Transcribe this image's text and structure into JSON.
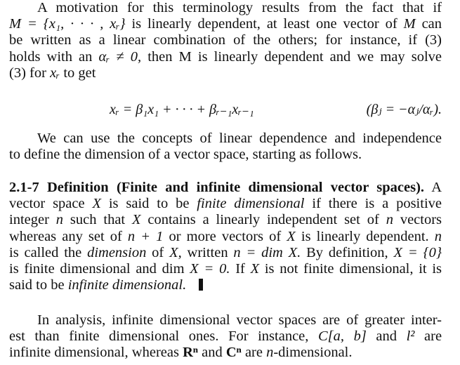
{
  "paragraph1": {
    "lines": [
      "A motivation for this terminology results from the fact that if",
      "is linearly dependent, at least one vector of",
      "be written as a linear combination of the others; for instance, if (3)",
      "holds with an",
      "(3) for"
    ],
    "set_M": "M = {x₁, · · · , xᵣ}",
    "vec_M": "M",
    "can": "can",
    "alpha_cond": "αᵣ ≠ 0,",
    "line4_rest": "then M is linearly dependent and we may solve",
    "x_r": "xᵣ",
    "to_get": "to get"
  },
  "equation": {
    "main": "xᵣ = β₁x₁ + · · · + βᵣ₋₁xᵣ₋₁",
    "condition": "(βⱼ = −αⱼ/αᵣ)."
  },
  "paragraph2": {
    "lines": [
      "We can use the concepts of linear dependence and independence",
      "to define the dimension of a vector space, starting as follows."
    ]
  },
  "definition": {
    "heading": "2.1-7 Definition (Finite and infinite dimensional vector spaces).",
    "lines": {
      "l1_start": "A",
      "l2_a": "vector space",
      "l2_X": "X",
      "l2_b": "is said to be",
      "l2_term": "finite dimensional",
      "l2_c": "if there is a positive",
      "l3_a": "integer",
      "l3_n": "n",
      "l3_b": "such that",
      "l3_X": "X",
      "l3_c": "contains a linearly independent set of",
      "l3_n2": "n",
      "l3_d": "vectors",
      "l4_a": "whereas any set of",
      "l4_n1": "n + 1",
      "l4_b": "or more vectors of",
      "l4_X": "X",
      "l4_c": "is linearly dependent.",
      "l4_n": "n",
      "l5_a": "is called the",
      "l5_term": "dimension",
      "l5_b": "of",
      "l5_X": "X,",
      "l5_c": "written",
      "l5_eq": "n = dim X.",
      "l5_d": "By definition,",
      "l5_set": "X = {0}",
      "l6_a": "is finite dimensional and dim",
      "l6_eq": "X = 0.",
      "l6_b": "If",
      "l6_X": "X",
      "l6_c": "is not finite dimensional, it is",
      "l7_a": "said to be",
      "l7_term": "infinite dimensional."
    }
  },
  "paragraph4": {
    "l1": "In analysis, infinite dimensional vector spaces are of greater inter-",
    "l2_a": "est than finite dimensional ones. For instance,",
    "l2_C": "C[a, b]",
    "l2_and": "and",
    "l2_l2": "l²",
    "l2_are": "are",
    "l3_a": "infinite dimensional, whereas",
    "l3_Rn": "Rⁿ",
    "l3_and": "and",
    "l3_Cn": "Cⁿ",
    "l3_b": "are",
    "l3_n": "n",
    "l3_c": "-dimensional."
  }
}
